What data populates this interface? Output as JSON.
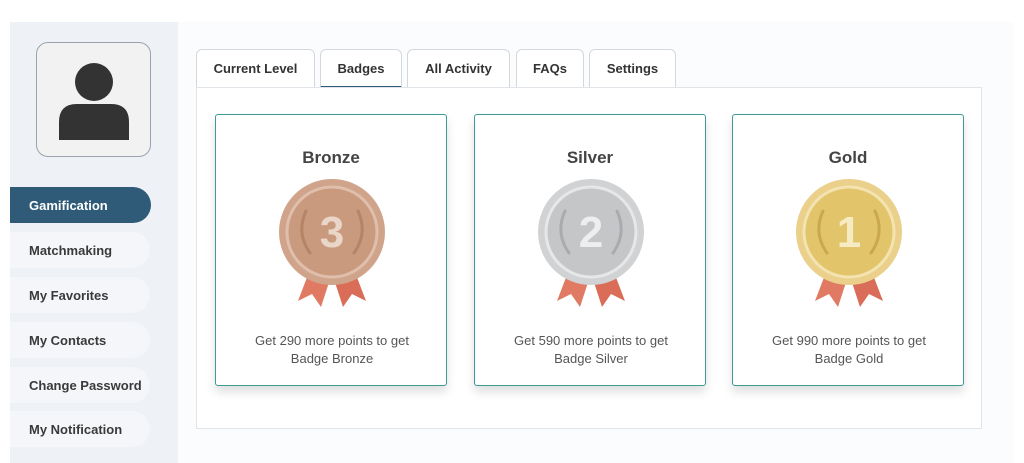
{
  "sidebar": {
    "avatar_icon": "user-icon",
    "items": [
      {
        "label": "Gamification",
        "active": true
      },
      {
        "label": "Matchmaking",
        "active": false
      },
      {
        "label": "My Favorites",
        "active": false
      },
      {
        "label": "My Contacts",
        "active": false
      },
      {
        "label": "Change Password",
        "active": false
      },
      {
        "label": "My Notification",
        "active": false
      }
    ]
  },
  "tabs": [
    {
      "label": "Current Level",
      "active": false
    },
    {
      "label": "Badges",
      "active": true
    },
    {
      "label": "All Activity",
      "active": false
    },
    {
      "label": "FAQs",
      "active": false
    },
    {
      "label": "Settings",
      "active": false
    }
  ],
  "badges": [
    {
      "title": "Bronze",
      "number": "3",
      "line1": "Get 290 more points to get",
      "line2": "Badge Bronze",
      "color": "#c99a7e",
      "icon": "bronze-medal-icon"
    },
    {
      "title": "Silver",
      "number": "2",
      "line1": "Get 590 more points to get",
      "line2": "Badge Silver",
      "color": "#c4c6c8",
      "icon": "silver-medal-icon"
    },
    {
      "title": "Gold",
      "number": "1",
      "line1": "Get 990 more points to get",
      "line2": "Badge Gold",
      "color": "#e2c46a",
      "icon": "gold-medal-icon"
    }
  ],
  "colors": {
    "accent": "#2f5b78",
    "card_border": "#3d9a97",
    "ribbon": "#e07a63"
  }
}
